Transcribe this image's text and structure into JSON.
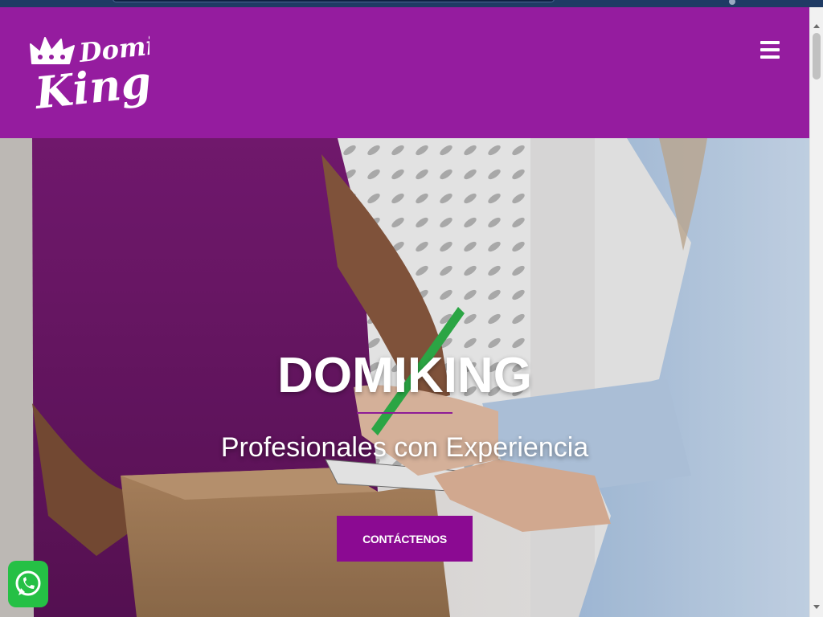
{
  "brand": {
    "logo_line1": "Domi",
    "logo_line2": "King",
    "logo_icon": "crown-icon",
    "color": "#951c9f"
  },
  "nav": {
    "menu_icon": "hamburger-menu-icon"
  },
  "hero": {
    "title": "DOMIKING",
    "subtitle": "Profesionales con Experiencia",
    "cta_label": "CONTÁCTENOS",
    "cta_color": "#8b0a92",
    "rule_color": "#8e1c97"
  },
  "floating": {
    "whatsapp_icon": "whatsapp-icon",
    "whatsapp_color": "#25c045"
  }
}
